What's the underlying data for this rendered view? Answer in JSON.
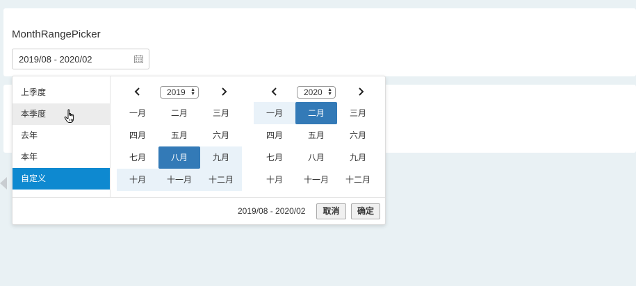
{
  "page": {
    "title": "MonthRangePicker",
    "input_value": "2019/08 - 2020/02"
  },
  "presets": [
    {
      "label": "上季度",
      "state": "normal"
    },
    {
      "label": "本季度",
      "state": "hover"
    },
    {
      "label": "去年",
      "state": "normal"
    },
    {
      "label": "本年",
      "state": "normal"
    },
    {
      "label": "自定义",
      "state": "active"
    }
  ],
  "calendar_left": {
    "year": "2019",
    "months": [
      "一月",
      "二月",
      "三月",
      "四月",
      "五月",
      "六月",
      "七月",
      "八月",
      "九月",
      "十月",
      "十一月",
      "十二月"
    ],
    "selected": [
      "八月"
    ],
    "in_range": [
      "九月",
      "十月",
      "十一月",
      "十二月"
    ]
  },
  "calendar_right": {
    "year": "2020",
    "months": [
      "一月",
      "二月",
      "三月",
      "四月",
      "五月",
      "六月",
      "七月",
      "八月",
      "九月",
      "十月",
      "十一月",
      "十二月"
    ],
    "selected": [
      "二月"
    ],
    "in_range": [
      "一月"
    ]
  },
  "footer": {
    "range_text": "2019/08 - 2020/02",
    "cancel_label": "取消",
    "ok_label": "确定"
  },
  "colors": {
    "accent": "#337ab7",
    "preset_active": "#0e89d0",
    "range_bg": "#e9f2f9",
    "page_bg": "#e9f1f4"
  },
  "icons": {
    "input": "calendar-icon",
    "prev": "chevron-left-icon",
    "next": "chevron-right-icon",
    "cursor": "hand-pointer-icon"
  }
}
